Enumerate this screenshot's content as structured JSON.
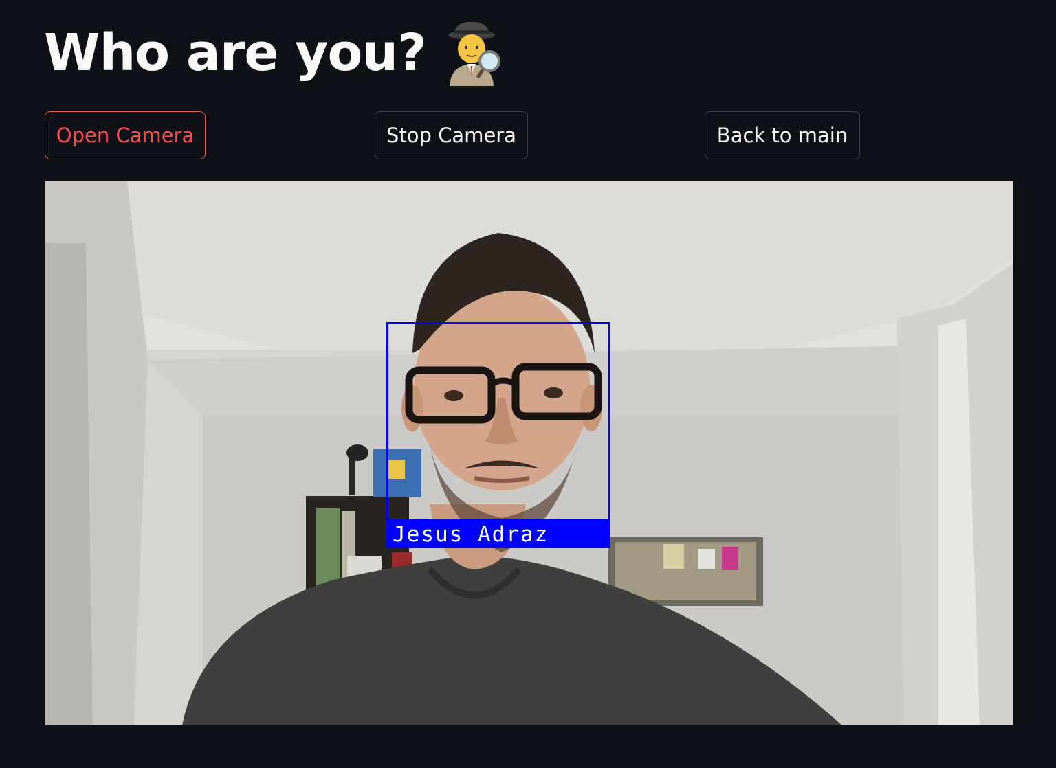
{
  "header": {
    "title": "Who are you?",
    "title_icon": "detective-emoji-icon"
  },
  "toolbar": {
    "open_camera_label": "Open Camera",
    "stop_camera_label": "Stop Camera",
    "back_label": "Back to main"
  },
  "camera": {
    "detected_name": "Jesus Adraz",
    "box_color": "#0000ff"
  },
  "colors": {
    "background": "#0e1117",
    "accent": "#ff4b4b",
    "text": "#fafafa"
  }
}
